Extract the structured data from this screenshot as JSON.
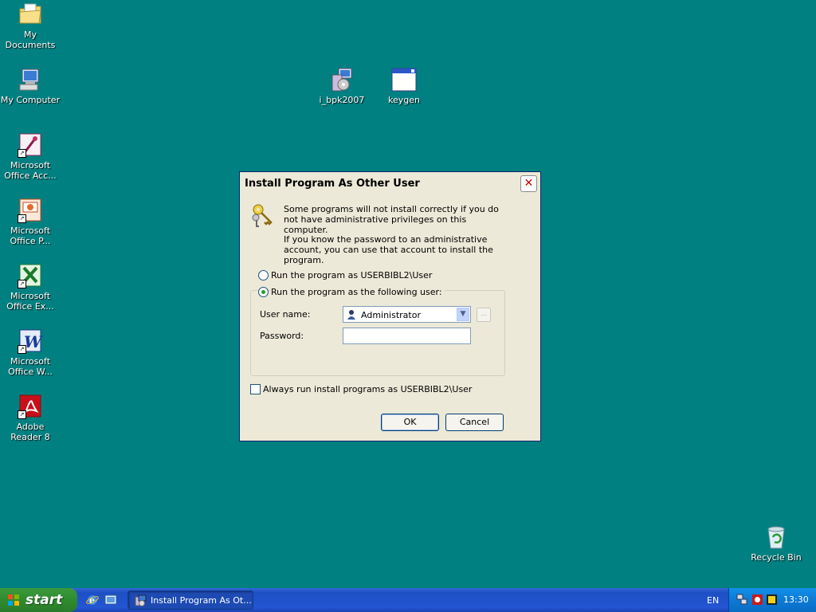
{
  "desktop": {
    "icons": [
      {
        "label": "My Documents"
      },
      {
        "label": "My Computer"
      },
      {
        "label": "Microsoft Office Acc..."
      },
      {
        "label": "Microsoft Office P..."
      },
      {
        "label": "Microsoft Office Ex..."
      },
      {
        "label": "Microsoft Office W..."
      },
      {
        "label": "Adobe Reader 8"
      },
      {
        "label": "i_bpk2007"
      },
      {
        "label": "keygen"
      },
      {
        "label": "Recycle Bin"
      }
    ]
  },
  "dialog": {
    "title": "Install Program As Other User",
    "close_glyph": "✕",
    "message1": "Some programs will not install correctly if you do not have administrative privileges on this computer.",
    "message2": "If you know the password to an administrative account, you can use that account to install the program.",
    "radio_current": "Run the program as USERBIBL2\\User",
    "radio_other": "Run the program as the following user:",
    "selected_option": "radio_other",
    "username_label": "User name:",
    "username_value": "Administrator",
    "password_label": "Password:",
    "password_value": "",
    "browse_label": "...",
    "always_label": "Always run install programs as USERBIBL2\\User",
    "always_checked": false,
    "ok_label": "OK",
    "cancel_label": "Cancel"
  },
  "taskbar": {
    "start_label": "start",
    "task_label": "Install Program As Ot...",
    "language": "EN",
    "clock": "13:30"
  },
  "colors": {
    "desktop": "#008080",
    "taskbar": "#245edb",
    "start": "#3c9a3c",
    "dialog_bg": "#ece9d8"
  }
}
